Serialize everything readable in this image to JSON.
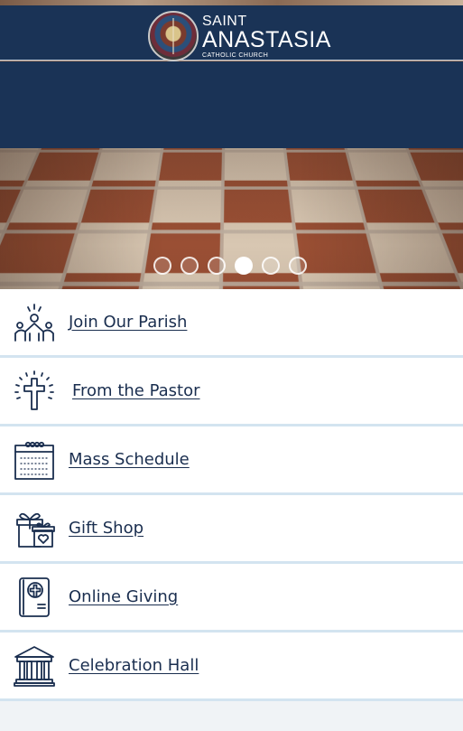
{
  "header": {
    "logo": {
      "line1": "SAINT",
      "line2": "ANASTASIA",
      "line3": "CATHOLIC CHURCH"
    }
  },
  "carousel": {
    "slide_count": 6,
    "active_index": 3
  },
  "menu": {
    "items": [
      {
        "label": "Join Our Parish",
        "icon": "people-raising-hands-icon"
      },
      {
        "label": "From the Pastor",
        "icon": "radiant-cross-icon"
      },
      {
        "label": "Mass Schedule",
        "icon": "calendar-icon"
      },
      {
        "label": "Gift Shop",
        "icon": "gift-box-icon"
      },
      {
        "label": "Online Giving",
        "icon": "tablet-cross-icon"
      },
      {
        "label": "Celebration Hall",
        "icon": "hall-building-icon"
      }
    ]
  },
  "colors": {
    "navy": "#1a3356",
    "link": "#1a2e4f",
    "divider": "#d3e4f0"
  }
}
